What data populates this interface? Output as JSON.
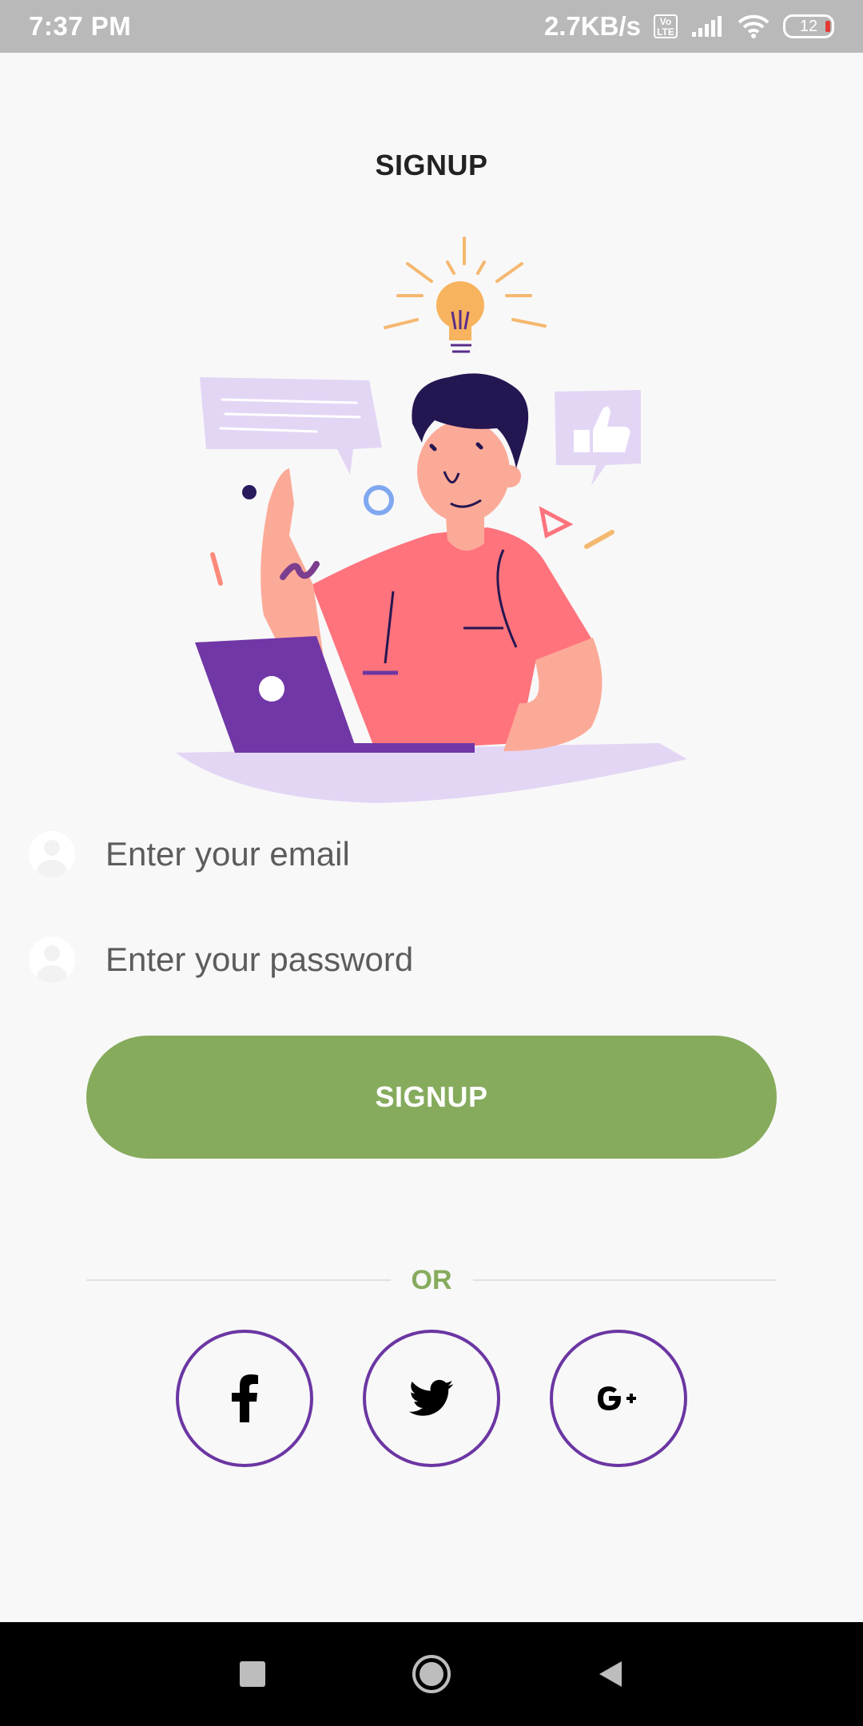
{
  "status_bar": {
    "time": "7:37 PM",
    "net_speed": "2.7KB/s",
    "volte": "Vo LTE",
    "battery": "12"
  },
  "title": "SIGNUP",
  "form": {
    "email_placeholder": "Enter your email",
    "password_placeholder": "Enter your password",
    "signup_label": "SIGNUP"
  },
  "divider": {
    "or_label": "OR"
  },
  "social": [
    {
      "name": "facebook",
      "icon": "facebook-icon"
    },
    {
      "name": "twitter",
      "icon": "twitter-icon"
    },
    {
      "name": "google-plus",
      "icon": "google-plus-icon"
    }
  ],
  "colors": {
    "accent_green": "#86ab5d",
    "social_border": "#6b36a3",
    "laptop_purple": "#7137a6",
    "shirt_pink": "#ff737d",
    "lavender": "#e3d6f5"
  }
}
